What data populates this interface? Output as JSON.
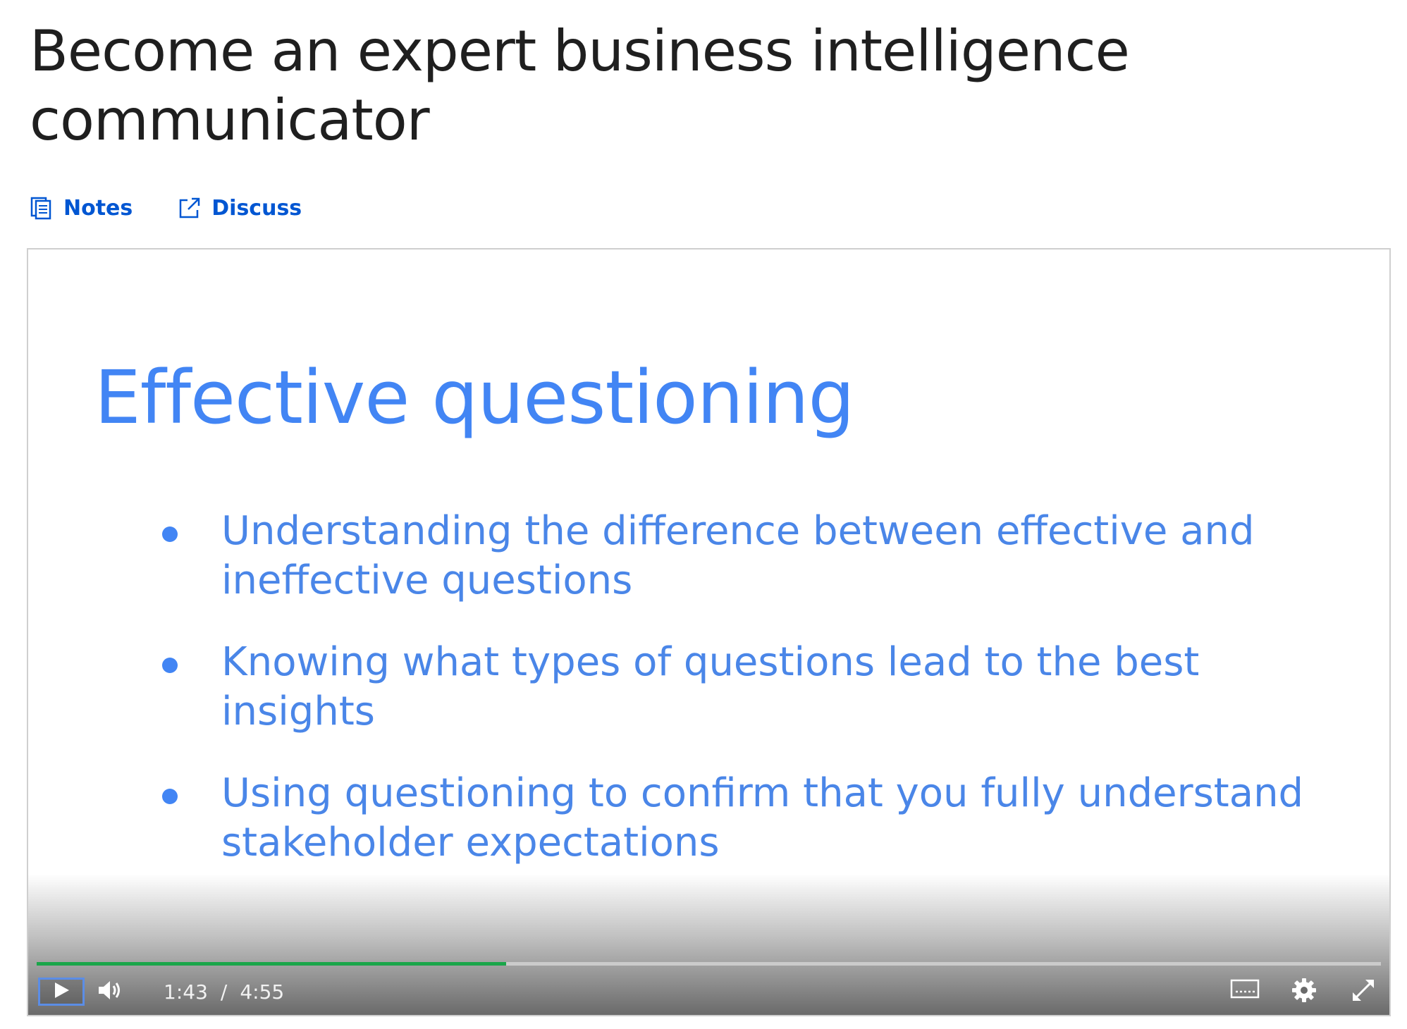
{
  "page": {
    "title": "Become an expert business intelligence communicator"
  },
  "actions": {
    "notes_label": "Notes",
    "notes_icon": "notes-icon",
    "discuss_label": "Discuss",
    "discuss_icon": "external-link-icon"
  },
  "slide": {
    "title": "Effective questioning",
    "bullets": [
      "Understanding the difference between effective and ineffective questions",
      "Knowing what types of questions lead to the best insights",
      "Using questioning to confirm that you fully understand stakeholder expectations"
    ]
  },
  "player": {
    "current_time": "1:43",
    "separator": "/",
    "duration": "4:55",
    "progress_fraction": 0.349,
    "icons": {
      "play": "play-icon",
      "volume": "volume-icon",
      "captions": "closed-captions-icon",
      "settings": "settings-gear-icon",
      "fullscreen": "fullscreen-icon"
    }
  },
  "colors": {
    "link": "#0056d2",
    "slide_accent": "#4285f4",
    "progress": "#1aa64a"
  }
}
